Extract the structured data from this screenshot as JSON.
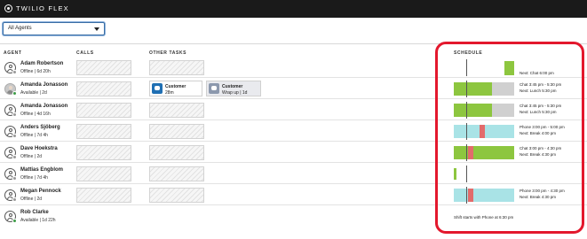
{
  "app": {
    "title": "TWILIO FLEX"
  },
  "filter": {
    "selected": "All Agents"
  },
  "columns": {
    "agent": "AGENT",
    "calls": "CALLS",
    "other_tasks": "OTHER TASKS",
    "schedule": "SCHEDULE"
  },
  "colors": {
    "topbar": "#1a1a1a",
    "available": "#3b9b46",
    "offline": "#999999",
    "chat_task": "#1f6fb3",
    "wrapup_task": "#8c98ad",
    "sched_green": "#8dc63f",
    "sched_lunch": "#d0d0d0",
    "sched_phone": "#a9e3e6",
    "sched_break": "#e26b6b",
    "highlight": "#e3182d"
  },
  "agents": [
    {
      "name": "Adam Robertson",
      "status": "Offline | 6d 20h",
      "availability": "offline",
      "photo": false,
      "schedule_text": [
        "Next: Chat 6:00 pm"
      ]
    },
    {
      "name": "Amanda Jonasson",
      "status": "Available | 2d",
      "availability": "available",
      "photo": true,
      "tasks": [
        {
          "title": "Customer",
          "subtitle": "28m",
          "kind": "chat",
          "icon": "chat-icon"
        },
        {
          "title": "Customer",
          "subtitle": "Wrap up | 1d",
          "kind": "wrapup",
          "icon": "chat-icon"
        }
      ],
      "schedule_text": [
        "Chat 3:45 pm - 5:30 pm",
        "Next: Lunch 5:30 pm"
      ]
    },
    {
      "name": "Amanda Jonasson",
      "status": "Offline | 4d 16h",
      "availability": "offline",
      "photo": false,
      "schedule_text": [
        "Chat 3:45 pm - 5:30 pm",
        "Next: Lunch 5:30 pm"
      ]
    },
    {
      "name": "Anders Sjöberg",
      "status": "Offline | 7d 4h",
      "availability": "offline",
      "photo": false,
      "schedule_text": [
        "Phone 3:00 pm - 5:00 pm",
        "Next: Break 4:00 pm"
      ]
    },
    {
      "name": "Dave Hoekstra",
      "status": "Offline | 2d",
      "availability": "offline",
      "photo": false,
      "schedule_text": [
        "Chat 3:00 pm - 4:30 pm",
        "Next: Break 4:30 pm"
      ]
    },
    {
      "name": "Mattias Engblom",
      "status": "Offline | 7d 4h",
      "availability": "offline",
      "photo": false,
      "schedule_text": []
    },
    {
      "name": "Megan Pennock",
      "status": "Offline | 2d",
      "availability": "offline",
      "photo": false,
      "schedule_text": [
        "Phone 3:00 pm - 4:30 pm",
        "Next: Break 4:30 pm"
      ]
    },
    {
      "name": "Rob Clarke",
      "status": "Available | 1d 22h",
      "availability": "available",
      "photo": false,
      "schedule_text": [
        "Shift starts with Phone at 6:30 pm"
      ]
    }
  ]
}
